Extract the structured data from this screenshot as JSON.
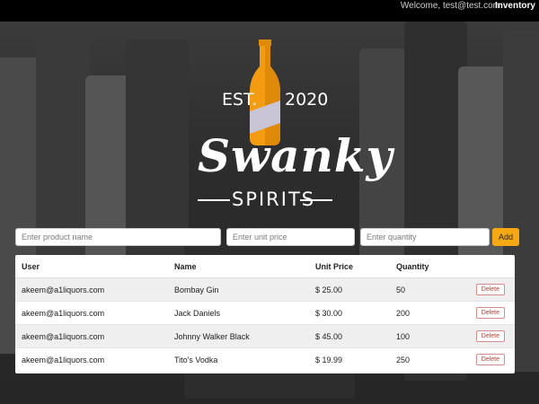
{
  "topbar": {
    "welcome": "Welcome, test@test.com",
    "nav_link": "Inventory"
  },
  "brand": {
    "est": "EST.",
    "year": "2020",
    "name": "Swanky",
    "sub": "SPIRITS"
  },
  "form": {
    "product_placeholder": "Enter product name",
    "price_placeholder": "Enter unit price",
    "qty_placeholder": "Enter quantity",
    "add_label": "Add"
  },
  "table": {
    "headers": [
      "User",
      "Name",
      "Unit Price",
      "Quantity",
      ""
    ],
    "rows": [
      {
        "user": "akeem@a1liquors.com",
        "name": "Bombay Gin",
        "price": "$ 25.00",
        "qty": "50",
        "action": "Delete"
      },
      {
        "user": "akeem@a1liquors.com",
        "name": "Jack Daniels",
        "price": "$ 30.00",
        "qty": "200",
        "action": "Delete"
      },
      {
        "user": "akeem@a1liquors.com",
        "name": "Johnny Walker Black",
        "price": "$ 45.00",
        "qty": "100",
        "action": "Delete"
      },
      {
        "user": "akeem@a1liquors.com",
        "name": "Tito's Vodka",
        "price": "$ 19.99",
        "qty": "250",
        "action": "Delete"
      }
    ]
  },
  "colors": {
    "accent": "#f5a814",
    "bottle": "#f39c12",
    "delete": "#c0392b"
  }
}
